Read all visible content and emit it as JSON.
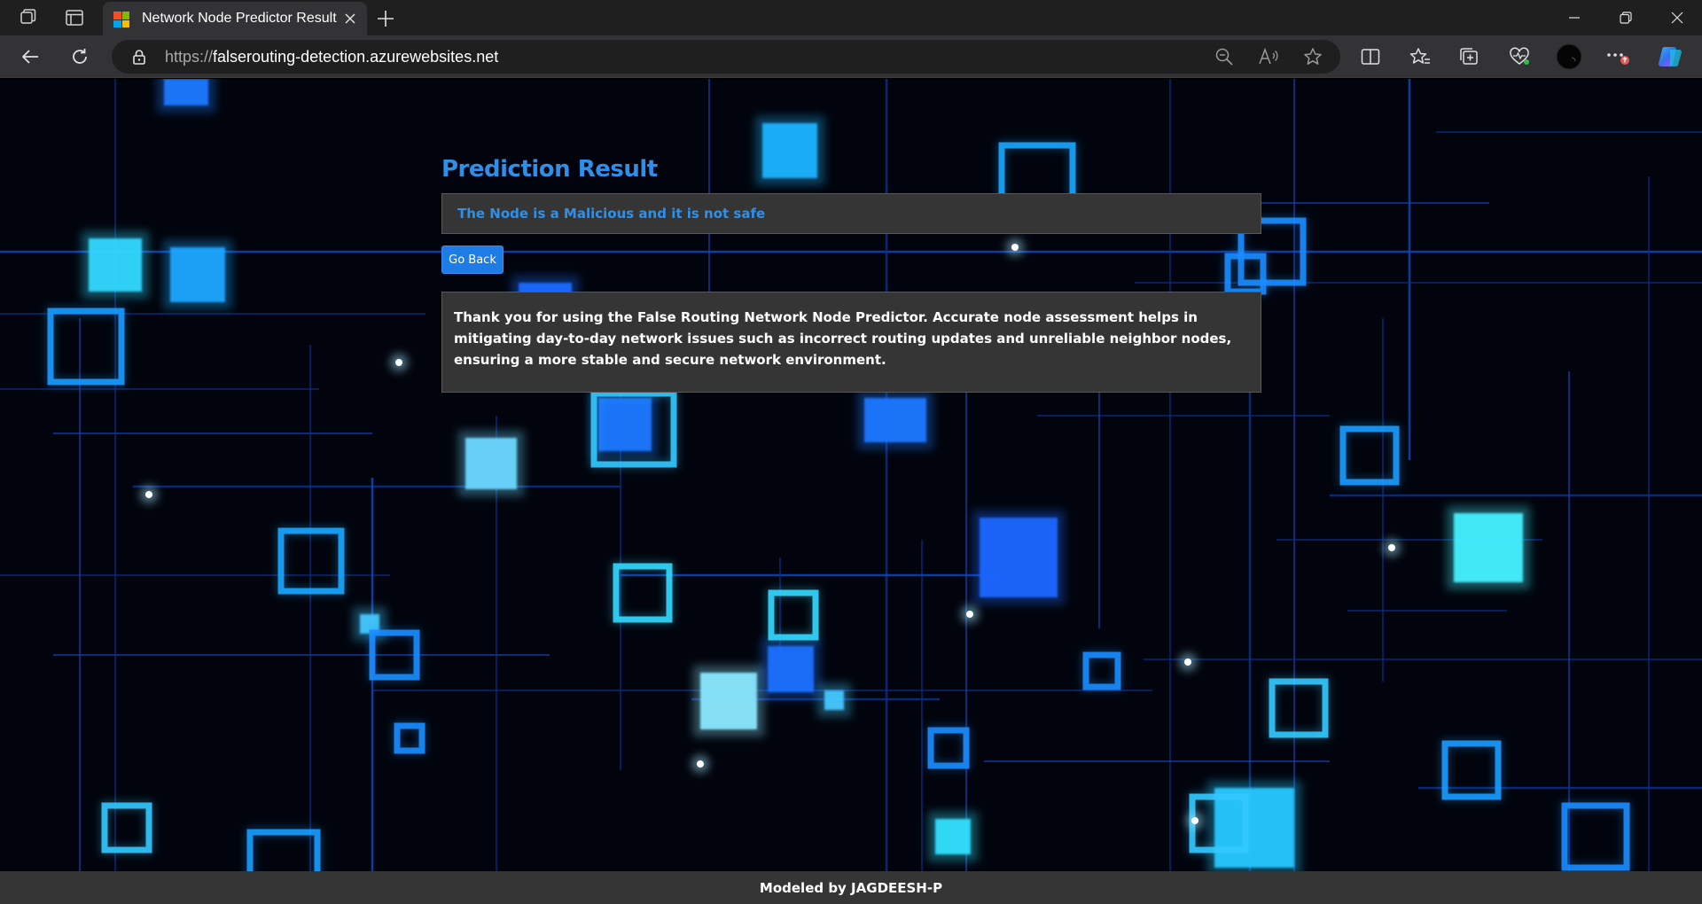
{
  "browser": {
    "tab_title": "Network Node Predictor Result",
    "url_protocol": "https://",
    "url_host": "falserouting-detection.azurewebsites.net",
    "icons": [
      "workspaces-icon",
      "tab-actions-icon",
      "microsoft-favicon",
      "close-tab-icon",
      "new-tab-icon",
      "minimize-icon",
      "restore-icon",
      "close-window-icon",
      "back-icon",
      "refresh-icon",
      "lock-icon",
      "zoom-out-icon",
      "read-aloud-icon",
      "add-favorite-icon",
      "split-screen-icon",
      "favorites-icon",
      "collections-icon",
      "browser-essentials-icon",
      "profile-avatar",
      "more-options-icon",
      "copilot-icon"
    ]
  },
  "page": {
    "heading": "Prediction Result",
    "result_text": "The Node is a Malicious and it is not safe",
    "go_back_label": "Go Back",
    "info_text": "Thank you for using the False Routing Network Node Predictor. Accurate node assessment helps in mitigating day-to-day network issues such as incorrect routing updates and unreliable neighbor nodes, ensuring a more stable and secure network environment.",
    "footer_text": "Modeled by JAGDEESH-P"
  },
  "colors": {
    "heading": "#2d8fe8",
    "result_text": "#2f90ea",
    "button": "#1e7ce6",
    "panel": "#353535",
    "background": "#01040c",
    "neon": "#1a8cff"
  }
}
